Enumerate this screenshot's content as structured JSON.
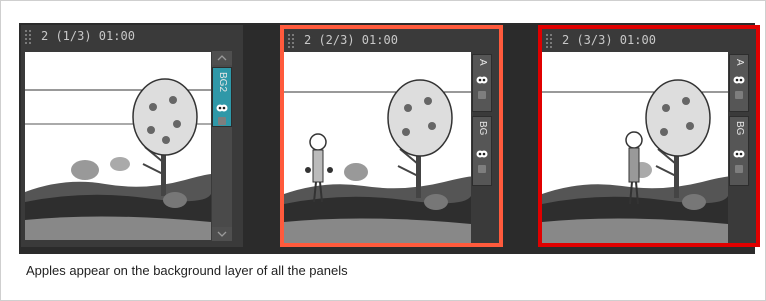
{
  "panels": [
    {
      "title": "2 (1/3) 01:00",
      "layers": [
        {
          "name": "BG2"
        }
      ]
    },
    {
      "title": "2 (2/3) 01:00",
      "layers": [
        {
          "name": "A"
        },
        {
          "name": "BG"
        }
      ]
    },
    {
      "title": "2 (3/3) 01:00",
      "layers": [
        {
          "name": "A"
        },
        {
          "name": "BG"
        }
      ]
    }
  ],
  "caption": "Apples appear on the background layer of all the panels",
  "colors": {
    "strip": "#2b2b2b",
    "panel_selected": "#ff5a3c",
    "panel_current": "#e00000",
    "active_layer": "#2f98a8"
  }
}
